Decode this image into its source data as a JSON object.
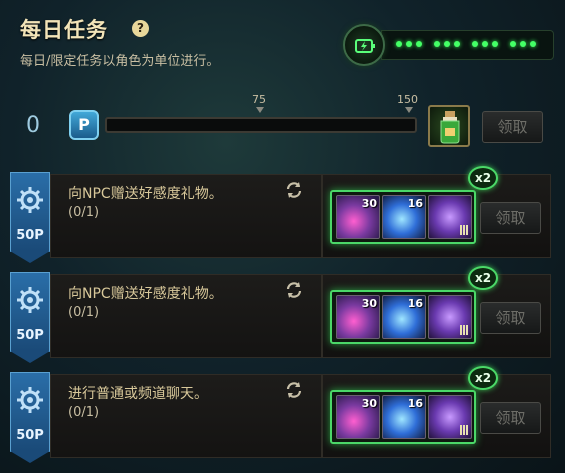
{
  "header": {
    "title": "每日任务",
    "help_icon": "?",
    "subtitle": "每日/限定任务以角色为单位进行。"
  },
  "energy": {
    "icon": "energy-bolt-icon",
    "dots": 12
  },
  "progress": {
    "points": "0",
    "points_icon": "P",
    "marks": [
      "75",
      "150"
    ],
    "fill_fraction": 0,
    "chest_icon": "potion-chest-icon",
    "claim_label": "领取"
  },
  "tasks": [
    {
      "points": "50P",
      "name": "向NPC赠送好感度礼物。",
      "progress": "(0/1)",
      "multiplier": "x2",
      "rewards": [
        "30",
        "16",
        ""
      ],
      "claim_label": "领取"
    },
    {
      "points": "50P",
      "name": "向NPC赠送好感度礼物。",
      "progress": "(0/1)",
      "multiplier": "x2",
      "rewards": [
        "30",
        "16",
        ""
      ],
      "claim_label": "领取"
    },
    {
      "points": "50P",
      "name": "进行普通或频道聊天。",
      "progress": "(0/1)",
      "multiplier": "x2",
      "rewards": [
        "30",
        "16",
        ""
      ],
      "claim_label": "领取"
    }
  ],
  "colors": {
    "accent_green": "#4bd868",
    "badge_blue": "#2a6ea8",
    "title_gold": "#f2e4b8"
  }
}
